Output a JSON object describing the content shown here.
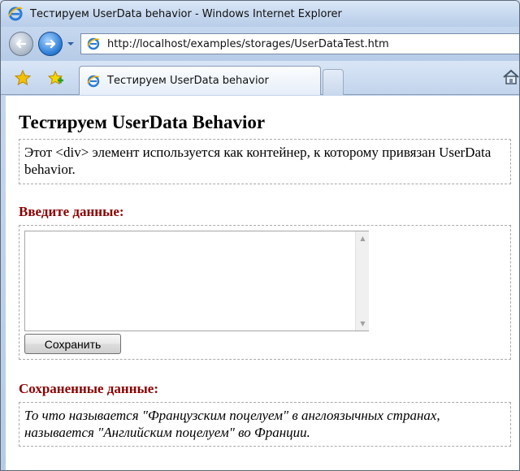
{
  "window": {
    "title": "Тестируем UserData behavior - Windows Internet Explorer"
  },
  "address_bar": {
    "url": "http://localhost/examples/storages/UserDataTest.htm"
  },
  "tabs": [
    {
      "label": "Тестируем UserData behavior"
    }
  ],
  "page": {
    "title": "Тестируем UserData Behavior",
    "description": "Этот <div> элемент используется как контейнер, к которому привязан UserData behavior.",
    "input_label": "Введите данные:",
    "textarea_value": "",
    "save_button_label": "Сохранить",
    "saved_label": "Сохраненные данные:",
    "saved_text": "То что называется \"Французским поцелуем\" в англоязычных странах, называется \"Английским поцелуем\" во Франции."
  },
  "icons": {
    "ie": "internet-explorer-icon",
    "back": "back-arrow-icon",
    "forward": "forward-arrow-icon",
    "dropdown": "chevron-down-icon",
    "page": "page-icon",
    "favorites": "star-icon",
    "add_favorites": "add-favorite-icon",
    "home": "home-icon"
  }
}
